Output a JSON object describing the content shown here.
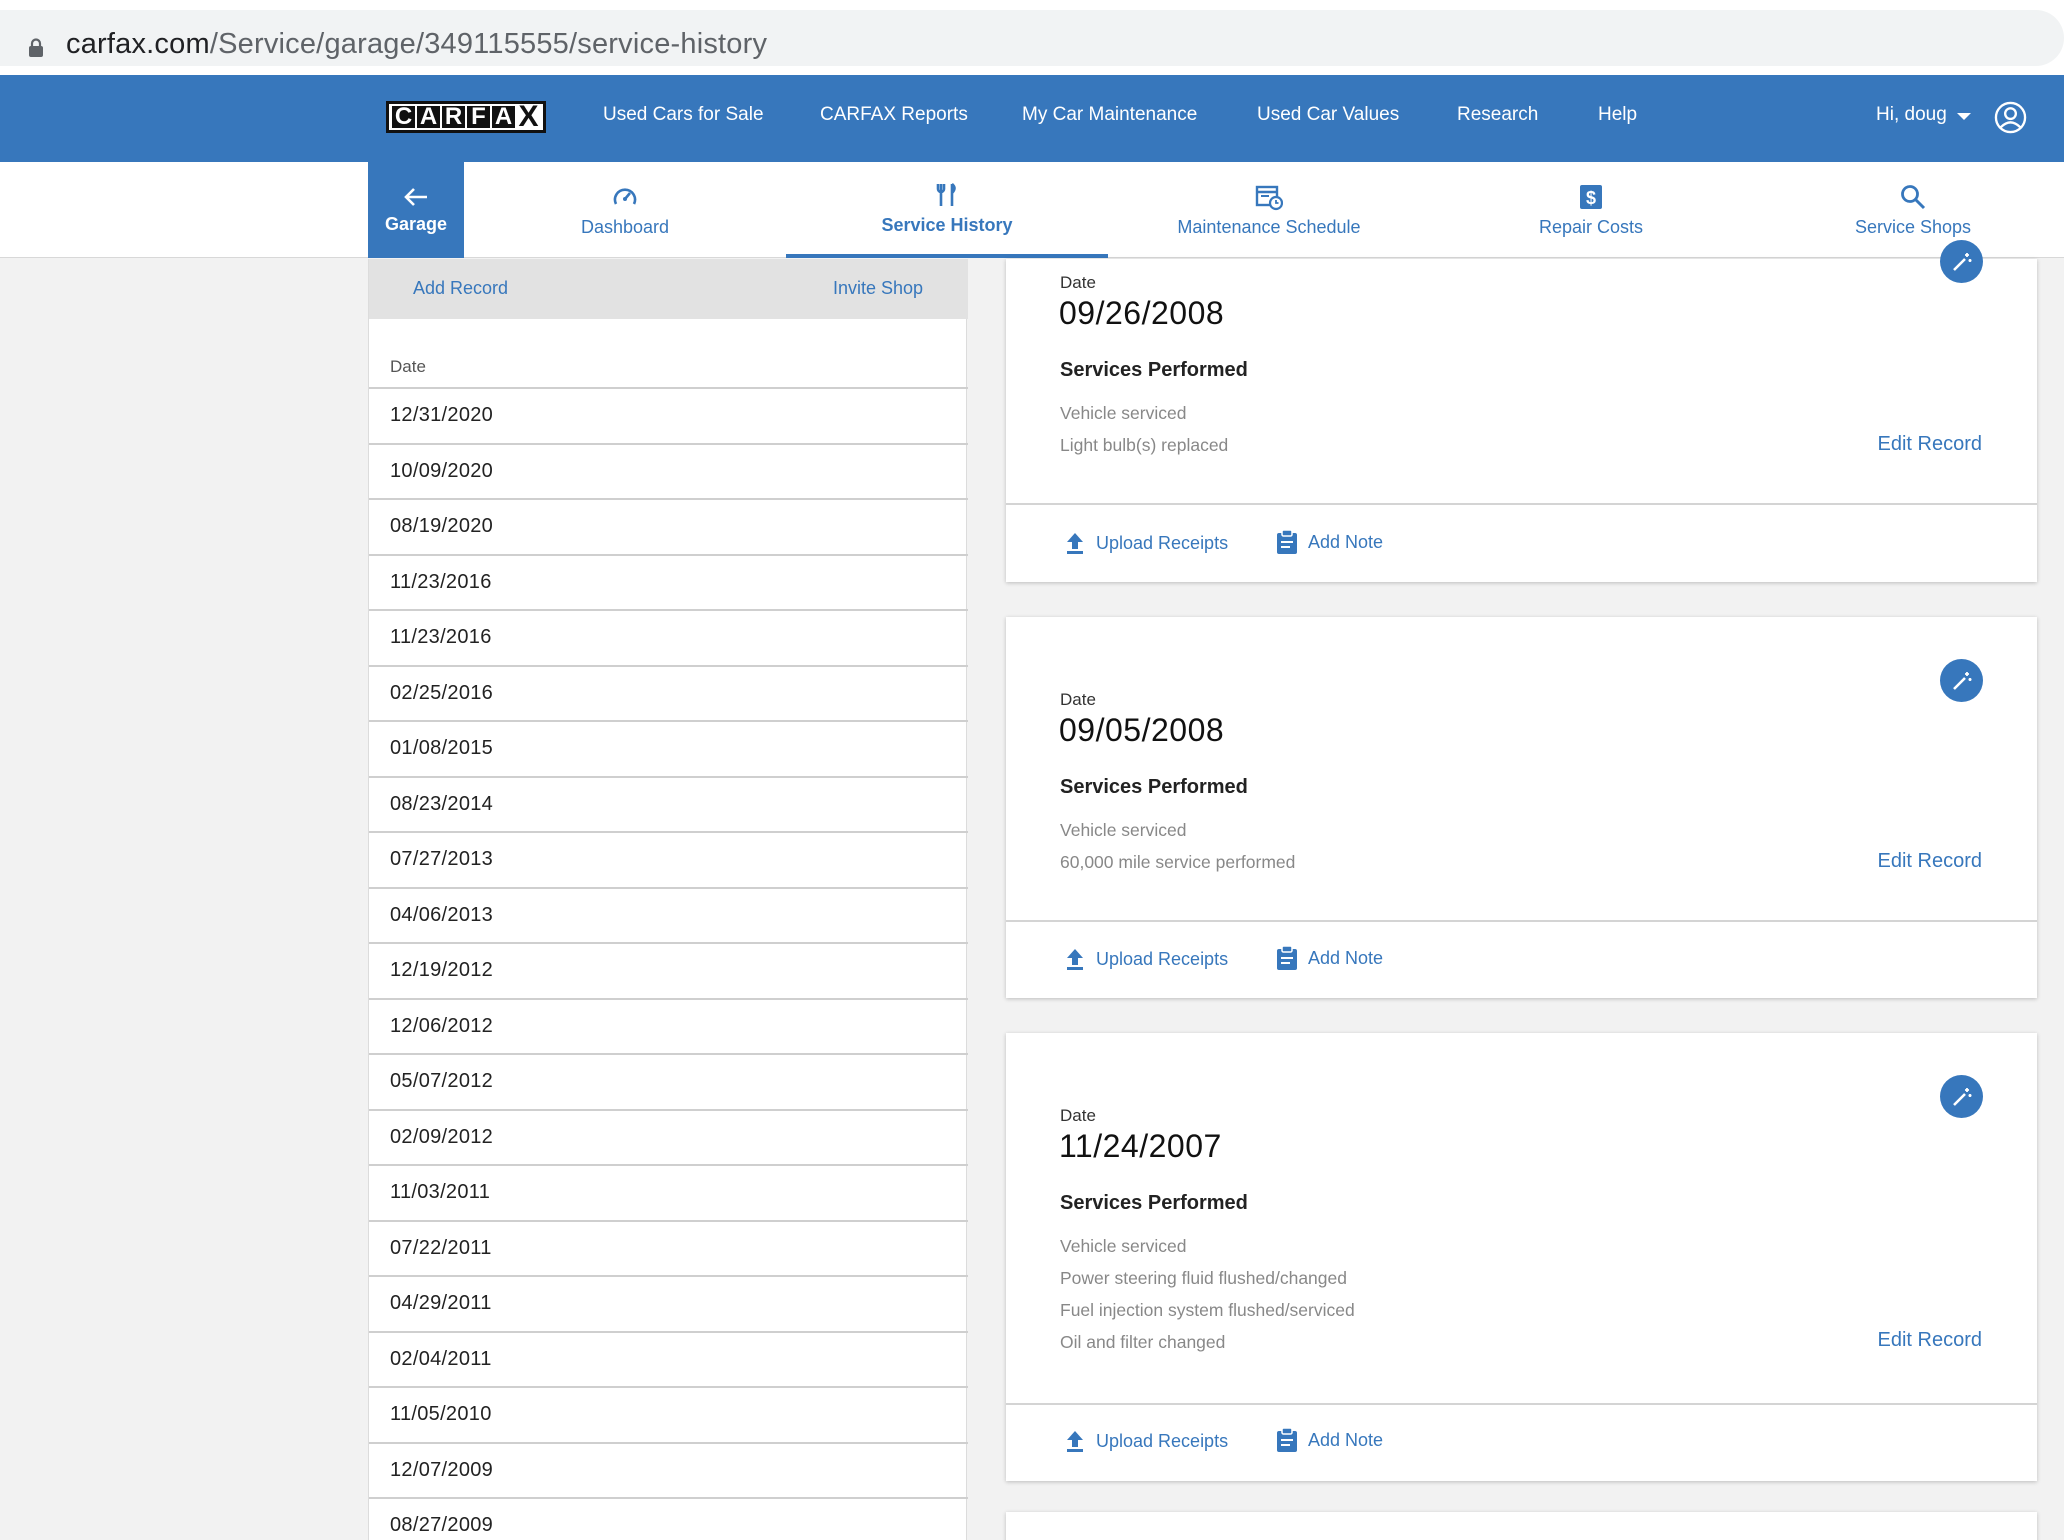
{
  "browser": {
    "url_host": "carfax.com",
    "url_path": "/Service/garage/349115555/service-history"
  },
  "topnav": {
    "logo_letters": [
      "C",
      "A",
      "R",
      "F",
      "A",
      "X"
    ],
    "links": [
      "Used Cars for Sale",
      "CARFAX Reports",
      "My Car Maintenance",
      "Used Car Values",
      "Research",
      "Help"
    ],
    "greeting": "Hi, doug"
  },
  "subnav": {
    "garage_label": "Garage",
    "tabs": [
      {
        "label": "Dashboard",
        "icon": "speedometer-icon"
      },
      {
        "label": "Service History",
        "icon": "wrench-tools-icon",
        "active": true
      },
      {
        "label": "Maintenance Schedule",
        "icon": "calendar-clock-icon"
      },
      {
        "label": "Repair Costs",
        "icon": "dollar-icon"
      },
      {
        "label": "Service Shops",
        "icon": "search-icon"
      }
    ]
  },
  "left": {
    "add_record": "Add Record",
    "invite_shop": "Invite Shop",
    "date_header": "Date",
    "dates": [
      "12/31/2020",
      "10/09/2020",
      "08/19/2020",
      "11/23/2016",
      "11/23/2016",
      "02/25/2016",
      "01/08/2015",
      "08/23/2014",
      "07/27/2013",
      "04/06/2013",
      "12/19/2012",
      "12/06/2012",
      "05/07/2012",
      "02/09/2012",
      "11/03/2011",
      "07/22/2011",
      "04/29/2011",
      "02/04/2011",
      "11/05/2010",
      "12/07/2009",
      "08/27/2009"
    ]
  },
  "records": [
    {
      "date_label": "Date",
      "date": "09/26/2008",
      "services_title": "Services Performed",
      "services": [
        "Vehicle serviced",
        "Light bulb(s) replaced"
      ],
      "edit_label": "Edit Record",
      "upload_label": "Upload Receipts",
      "note_label": "Add Note"
    },
    {
      "date_label": "Date",
      "date": "09/05/2008",
      "services_title": "Services Performed",
      "services": [
        "Vehicle serviced",
        "60,000 mile service performed"
      ],
      "edit_label": "Edit Record",
      "upload_label": "Upload Receipts",
      "note_label": "Add Note"
    },
    {
      "date_label": "Date",
      "date": "11/24/2007",
      "services_title": "Services Performed",
      "services": [
        "Vehicle serviced",
        "Power steering fluid flushed/changed",
        "Fuel injection system flushed/serviced",
        "Oil and filter changed"
      ],
      "edit_label": "Edit Record",
      "upload_label": "Upload Receipts",
      "note_label": "Add Note"
    }
  ],
  "colors": {
    "brand_blue": "#3777bc",
    "page_bg": "#f2f2f2"
  }
}
